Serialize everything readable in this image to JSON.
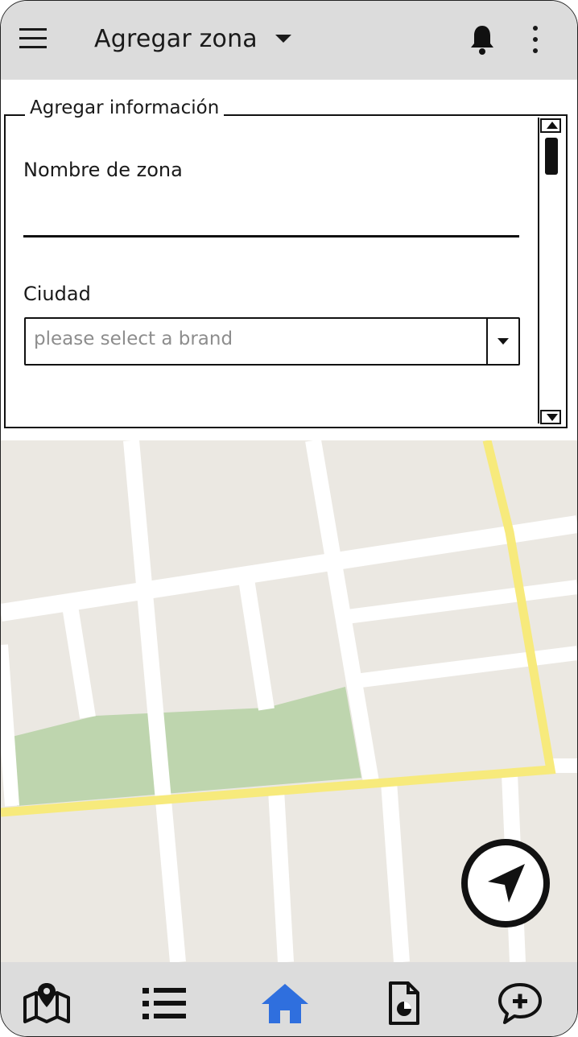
{
  "header": {
    "title": "Agregar zona",
    "icons": [
      "menu-icon",
      "chevron-down-icon",
      "bell-icon",
      "more-vertical-icon"
    ]
  },
  "form": {
    "legend": "Agregar información",
    "zone_name_label": "Nombre de zona",
    "zone_name_value": "",
    "city_label": "Ciudad",
    "city_placeholder": "please select a brand"
  },
  "map": {
    "colors": {
      "land": "#ebe8e2",
      "street": "#ffffff",
      "main_road": "#f7ea7c",
      "park": "#bed5ae"
    }
  },
  "bottom_nav": {
    "items": [
      "map-icon",
      "list-icon",
      "home-icon",
      "report-icon",
      "add-comment-icon"
    ],
    "active": "home-icon",
    "active_color": "#2f6fde"
  }
}
